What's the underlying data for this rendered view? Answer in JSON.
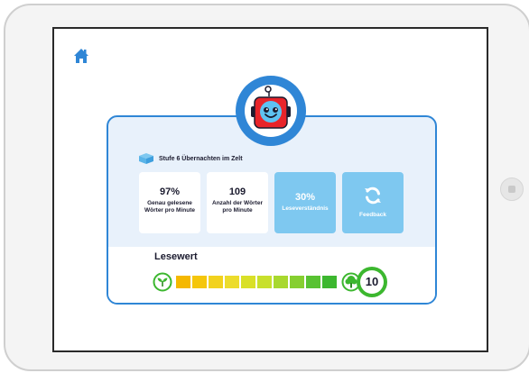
{
  "level": {
    "text": "Stufe 6 Übernachten im Zelt"
  },
  "stats": [
    {
      "value": "97%",
      "label": "Genau gelesene Wörter pro Minute"
    },
    {
      "value": "109",
      "label": "Anzahl der Wörter pro Minute"
    }
  ],
  "comprehension": {
    "value": "30%",
    "label": "Leseverständnis"
  },
  "feedback": {
    "label": "Feedback"
  },
  "reading_score": {
    "title": "Lesewert",
    "value": "10",
    "meter_fraction": 1.0,
    "segment_colors": [
      "#f5b800",
      "#f5c60a",
      "#f2d21e",
      "#ecdc2c",
      "#d9e028",
      "#c8e02c",
      "#a8d82e",
      "#86cf30",
      "#58c232",
      "#3cb72f"
    ]
  },
  "colors": {
    "accent_blue": "#2f86d6",
    "tile_blue": "#7ec8f0",
    "card_bg": "#e8f1fb",
    "score_green": "#3cb72f",
    "robot_red": "#e8242a"
  },
  "icons": {
    "home": "home-icon",
    "robot": "robot-avatar",
    "book": "book-icon",
    "feedback": "refresh-icon",
    "sprout": "sprout-icon",
    "tree": "tree-icon"
  }
}
